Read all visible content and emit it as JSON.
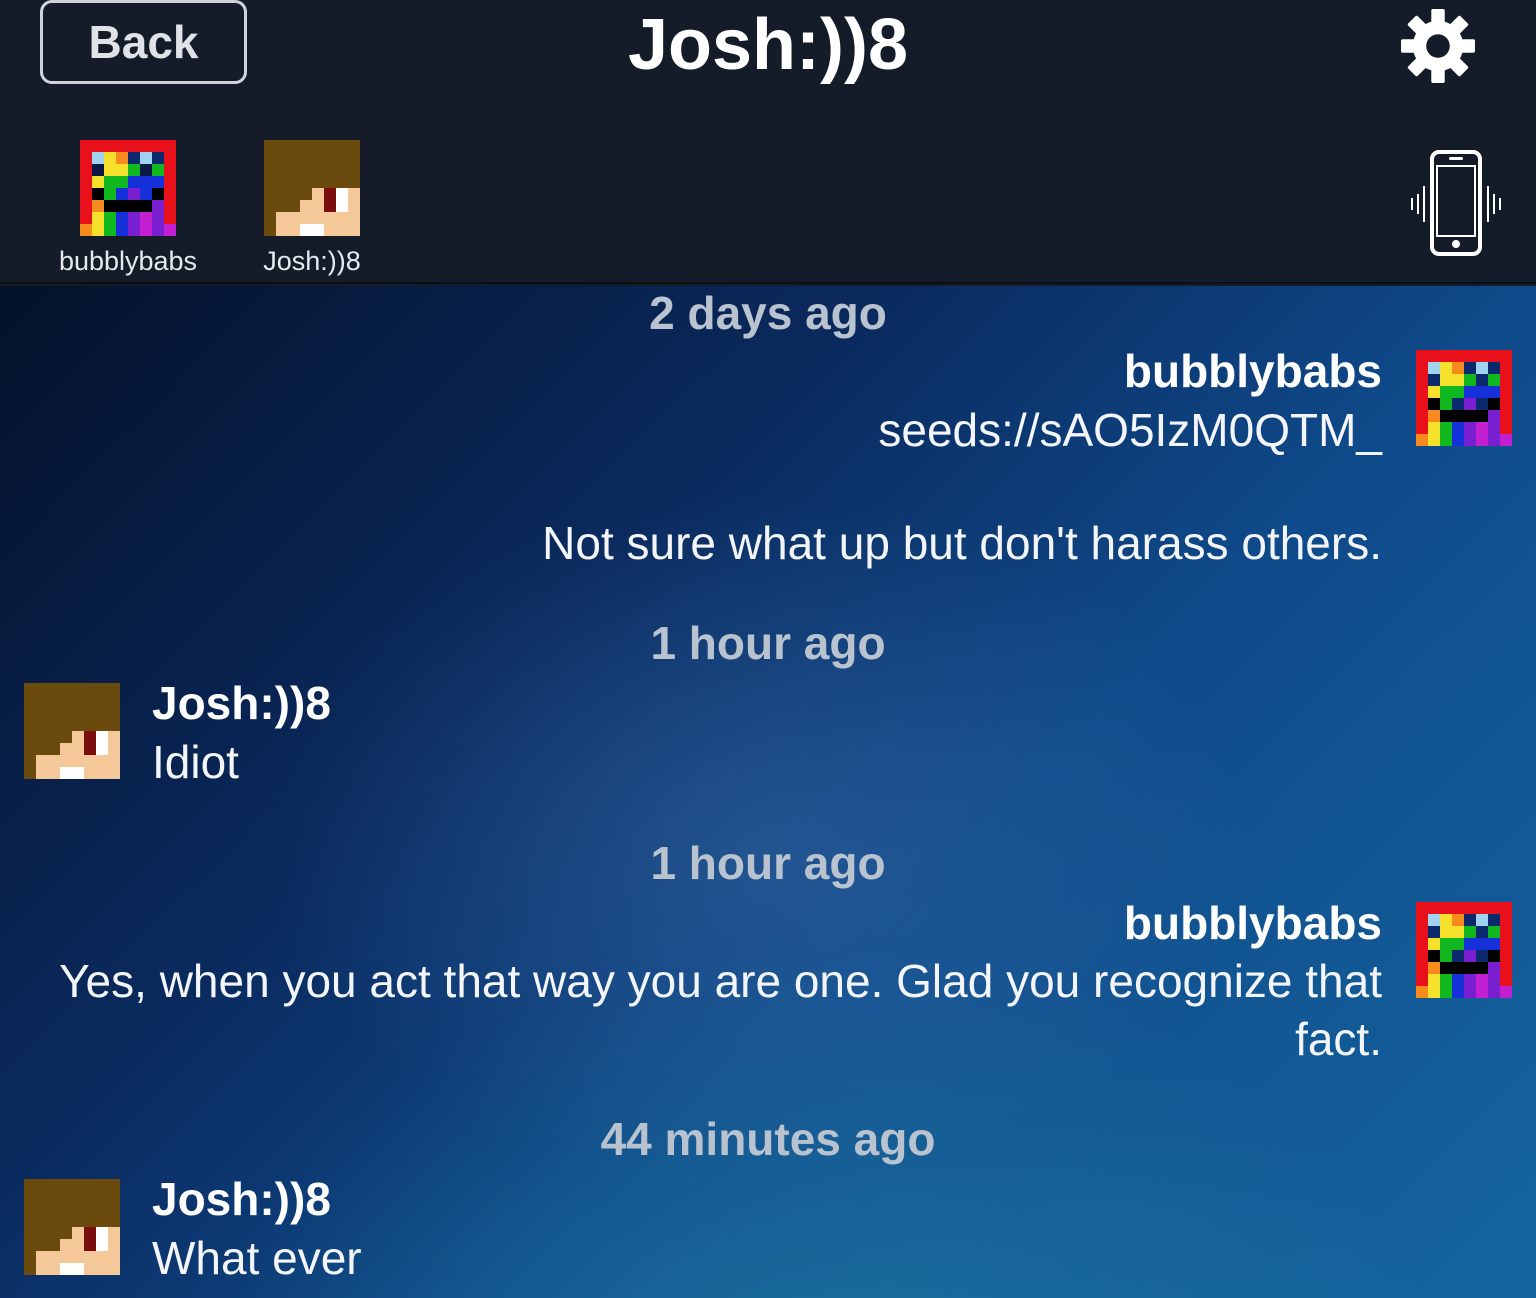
{
  "header": {
    "back_label": "Back",
    "title": "Josh:))8",
    "settings_icon": "gear-icon",
    "vibrate_icon": "phone-vibrate-icon"
  },
  "participants": [
    {
      "name": "bubblybabs",
      "avatar": "rainbow-pixel-avatar"
    },
    {
      "name": "Josh:))8",
      "avatar": "brown-hair-pixel-avatar"
    }
  ],
  "messages": [
    {
      "timestamp": "2 days ago",
      "sender": "bubblybabs",
      "lines": [
        "seeds://sAO5IzM0QTM_",
        "",
        "Not sure what up but don't harass others."
      ]
    },
    {
      "timestamp": "1 hour ago",
      "sender": "Josh:))8",
      "lines": [
        "Idiot"
      ]
    },
    {
      "timestamp": "1 hour ago",
      "sender": "bubblybabs",
      "lines": [
        "Yes, when you act that way you are one.  Glad you recognize that",
        "fact."
      ]
    },
    {
      "timestamp": "44 minutes ago",
      "sender": "Josh:))8",
      "lines": [
        "What ever"
      ]
    }
  ],
  "colors": {
    "header_bg": "#131c28",
    "text_white": "#ffffff",
    "timestamp": "#b9c3d0"
  }
}
